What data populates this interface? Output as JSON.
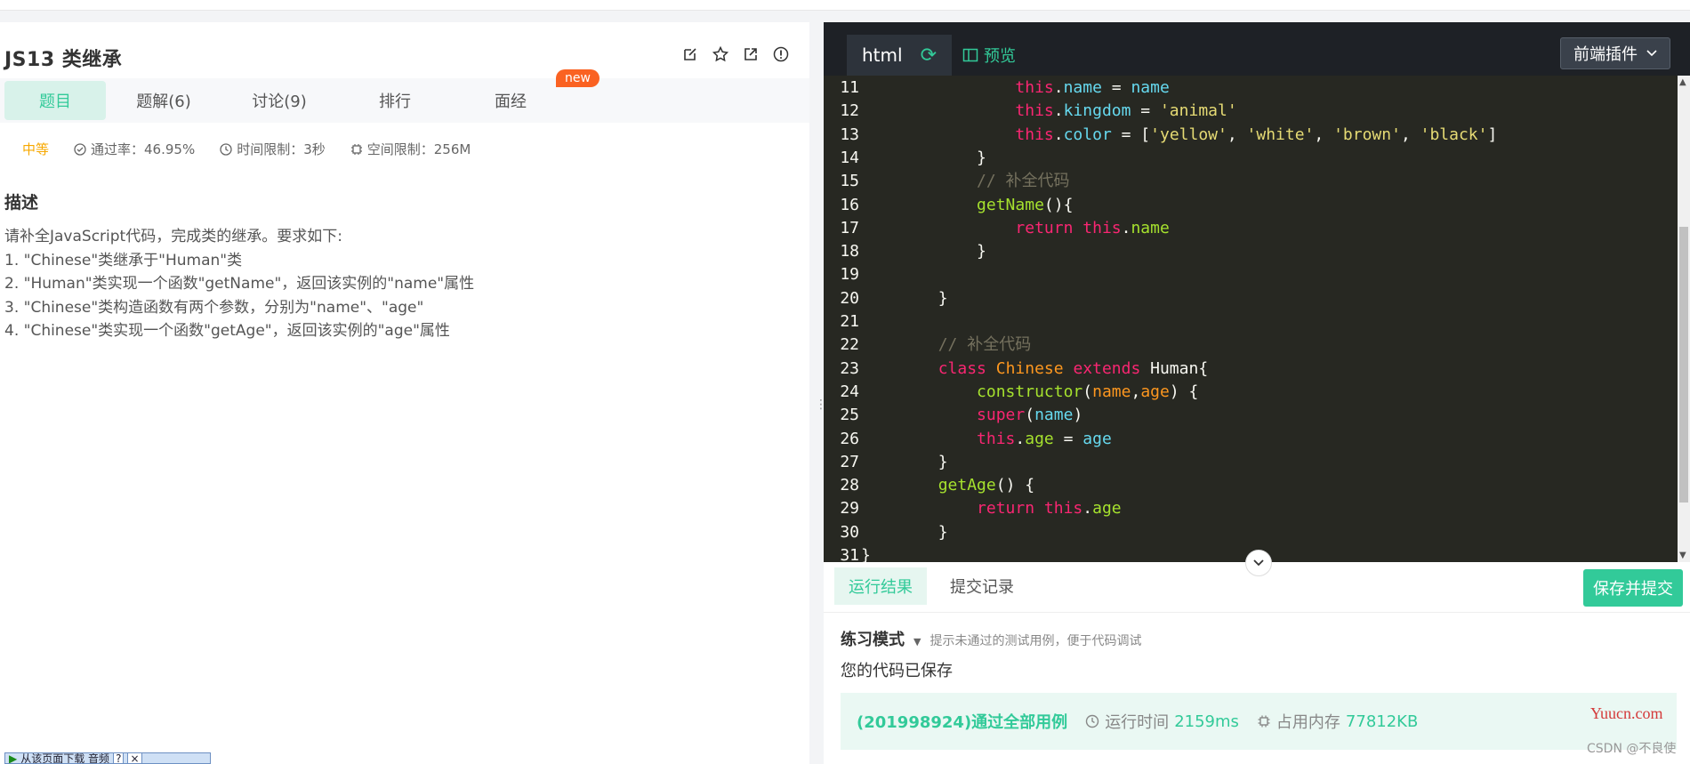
{
  "problem": {
    "title": "JS13  类继承",
    "tabs": [
      {
        "label": "题目"
      },
      {
        "label": "题解(6)"
      },
      {
        "label": "讨论(9)"
      },
      {
        "label": "排行"
      },
      {
        "label": "面经"
      }
    ],
    "new_badge": "new",
    "difficulty": "中等",
    "pass_rate": "通过率：46.95%",
    "time_limit": "时间限制：3秒",
    "space_limit": "空间限制：256M",
    "desc_title": "描述",
    "desc_lines": [
      "请补全JavaScript代码，完成类的继承。要求如下:",
      "1. \"Chinese\"类继承于\"Human\"类",
      "2. \"Human\"类实现一个函数\"getName\"，返回该实例的\"name\"属性",
      "3. \"Chinese\"类构造函数有两个参数，分别为\"name\"、\"age\"",
      "4. \"Chinese\"类实现一个函数\"getAge\"，返回该实例的\"age\"属性"
    ]
  },
  "download_bar": "从该页面下载 音频",
  "editor": {
    "lang": "html",
    "preview": "预览",
    "plugin": "前端插件",
    "code_lines": [
      {
        "n": "11",
        "tokens": [
          [
            "sp",
            "                "
          ],
          [
            "kw",
            "this"
          ],
          [
            "cl",
            "."
          ],
          [
            "prop",
            "name"
          ],
          [
            "cl",
            " = "
          ],
          [
            "prop",
            "name"
          ]
        ]
      },
      {
        "n": "12",
        "tokens": [
          [
            "sp",
            "                "
          ],
          [
            "kw",
            "this"
          ],
          [
            "cl",
            "."
          ],
          [
            "prop",
            "kingdom"
          ],
          [
            "cl",
            " = "
          ],
          [
            "str",
            "'animal'"
          ]
        ]
      },
      {
        "n": "13",
        "tokens": [
          [
            "sp",
            "                "
          ],
          [
            "kw",
            "this"
          ],
          [
            "cl",
            "."
          ],
          [
            "prop",
            "color"
          ],
          [
            "cl",
            " = ["
          ],
          [
            "str",
            "'yellow'"
          ],
          [
            "cl",
            ", "
          ],
          [
            "str",
            "'white'"
          ],
          [
            "cl",
            ", "
          ],
          [
            "str",
            "'brown'"
          ],
          [
            "cl",
            ", "
          ],
          [
            "str",
            "'black'"
          ],
          [
            "cl",
            "]"
          ]
        ]
      },
      {
        "n": "14",
        "tokens": [
          [
            "sp",
            "            "
          ],
          [
            "cl",
            "}"
          ]
        ]
      },
      {
        "n": "15",
        "tokens": [
          [
            "sp",
            "            "
          ],
          [
            "cm",
            "// 补全代码"
          ]
        ]
      },
      {
        "n": "16",
        "tokens": [
          [
            "sp",
            "            "
          ],
          [
            "fn",
            "getName"
          ],
          [
            "cl",
            "(){"
          ]
        ]
      },
      {
        "n": "17",
        "tokens": [
          [
            "sp",
            "                "
          ],
          [
            "kw",
            "return"
          ],
          [
            "cl",
            " "
          ],
          [
            "kw",
            "this"
          ],
          [
            "cl",
            "."
          ],
          [
            "fn",
            "name"
          ]
        ]
      },
      {
        "n": "18",
        "tokens": [
          [
            "sp",
            "            "
          ],
          [
            "cl",
            "}"
          ]
        ]
      },
      {
        "n": "19",
        "tokens": []
      },
      {
        "n": "20",
        "tokens": [
          [
            "sp",
            "        "
          ],
          [
            "cl",
            "}"
          ]
        ]
      },
      {
        "n": "21",
        "tokens": []
      },
      {
        "n": "22",
        "tokens": [
          [
            "sp",
            "        "
          ],
          [
            "cm",
            "// 补全代码"
          ]
        ]
      },
      {
        "n": "23",
        "tokens": [
          [
            "sp",
            "        "
          ],
          [
            "kw",
            "class"
          ],
          [
            "cl",
            " "
          ],
          [
            "prm",
            "Chinese"
          ],
          [
            "cl",
            " "
          ],
          [
            "kw",
            "extends"
          ],
          [
            "cl",
            " Human{"
          ]
        ]
      },
      {
        "n": "24",
        "tokens": [
          [
            "sp",
            "            "
          ],
          [
            "fn",
            "constructor"
          ],
          [
            "cl",
            "("
          ],
          [
            "prm",
            "name"
          ],
          [
            "cl",
            ","
          ],
          [
            "prm",
            "age"
          ],
          [
            "cl",
            ") {"
          ]
        ]
      },
      {
        "n": "25",
        "tokens": [
          [
            "sp",
            "            "
          ],
          [
            "kw",
            "super"
          ],
          [
            "cl",
            "("
          ],
          [
            "prop",
            "name"
          ],
          [
            "cl",
            ")"
          ]
        ]
      },
      {
        "n": "26",
        "tokens": [
          [
            "sp",
            "            "
          ],
          [
            "kw",
            "this"
          ],
          [
            "cl",
            "."
          ],
          [
            "fn",
            "age"
          ],
          [
            "cl",
            " = "
          ],
          [
            "prop",
            "age"
          ]
        ]
      },
      {
        "n": "27",
        "tokens": [
          [
            "sp",
            "        "
          ],
          [
            "cl",
            "}"
          ]
        ]
      },
      {
        "n": "28",
        "tokens": [
          [
            "sp",
            "        "
          ],
          [
            "fn",
            "getAge"
          ],
          [
            "cl",
            "() {"
          ]
        ]
      },
      {
        "n": "29",
        "tokens": [
          [
            "sp",
            "            "
          ],
          [
            "kw",
            "return"
          ],
          [
            "cl",
            " "
          ],
          [
            "kw",
            "this"
          ],
          [
            "cl",
            "."
          ],
          [
            "fn",
            "age"
          ]
        ]
      },
      {
        "n": "30",
        "tokens": [
          [
            "sp",
            "        "
          ],
          [
            "cl",
            "}"
          ]
        ]
      },
      {
        "n": "31",
        "tokens": [
          [
            "cl",
            "}"
          ]
        ]
      }
    ]
  },
  "result": {
    "tab_run": "运行结果",
    "tab_history": "提交记录",
    "submit": "保存并提交",
    "mode": "练习模式",
    "mode_hint": "提示未通过的测试用例，便于代码调试",
    "saved": "您的代码已保存",
    "pass": "(201998924)通过全部用例",
    "runtime_label": "运行时间",
    "runtime": "2159ms",
    "memory_label": "占用内存",
    "memory": "77812KB"
  },
  "watermark": {
    "site": "Yuucn.com",
    "credit": "CSDN @不良使"
  },
  "colors": {
    "accent": "#32ca99",
    "badge": "#fa6222",
    "difficulty": "#f7a800",
    "editor_bg": "#272822"
  }
}
